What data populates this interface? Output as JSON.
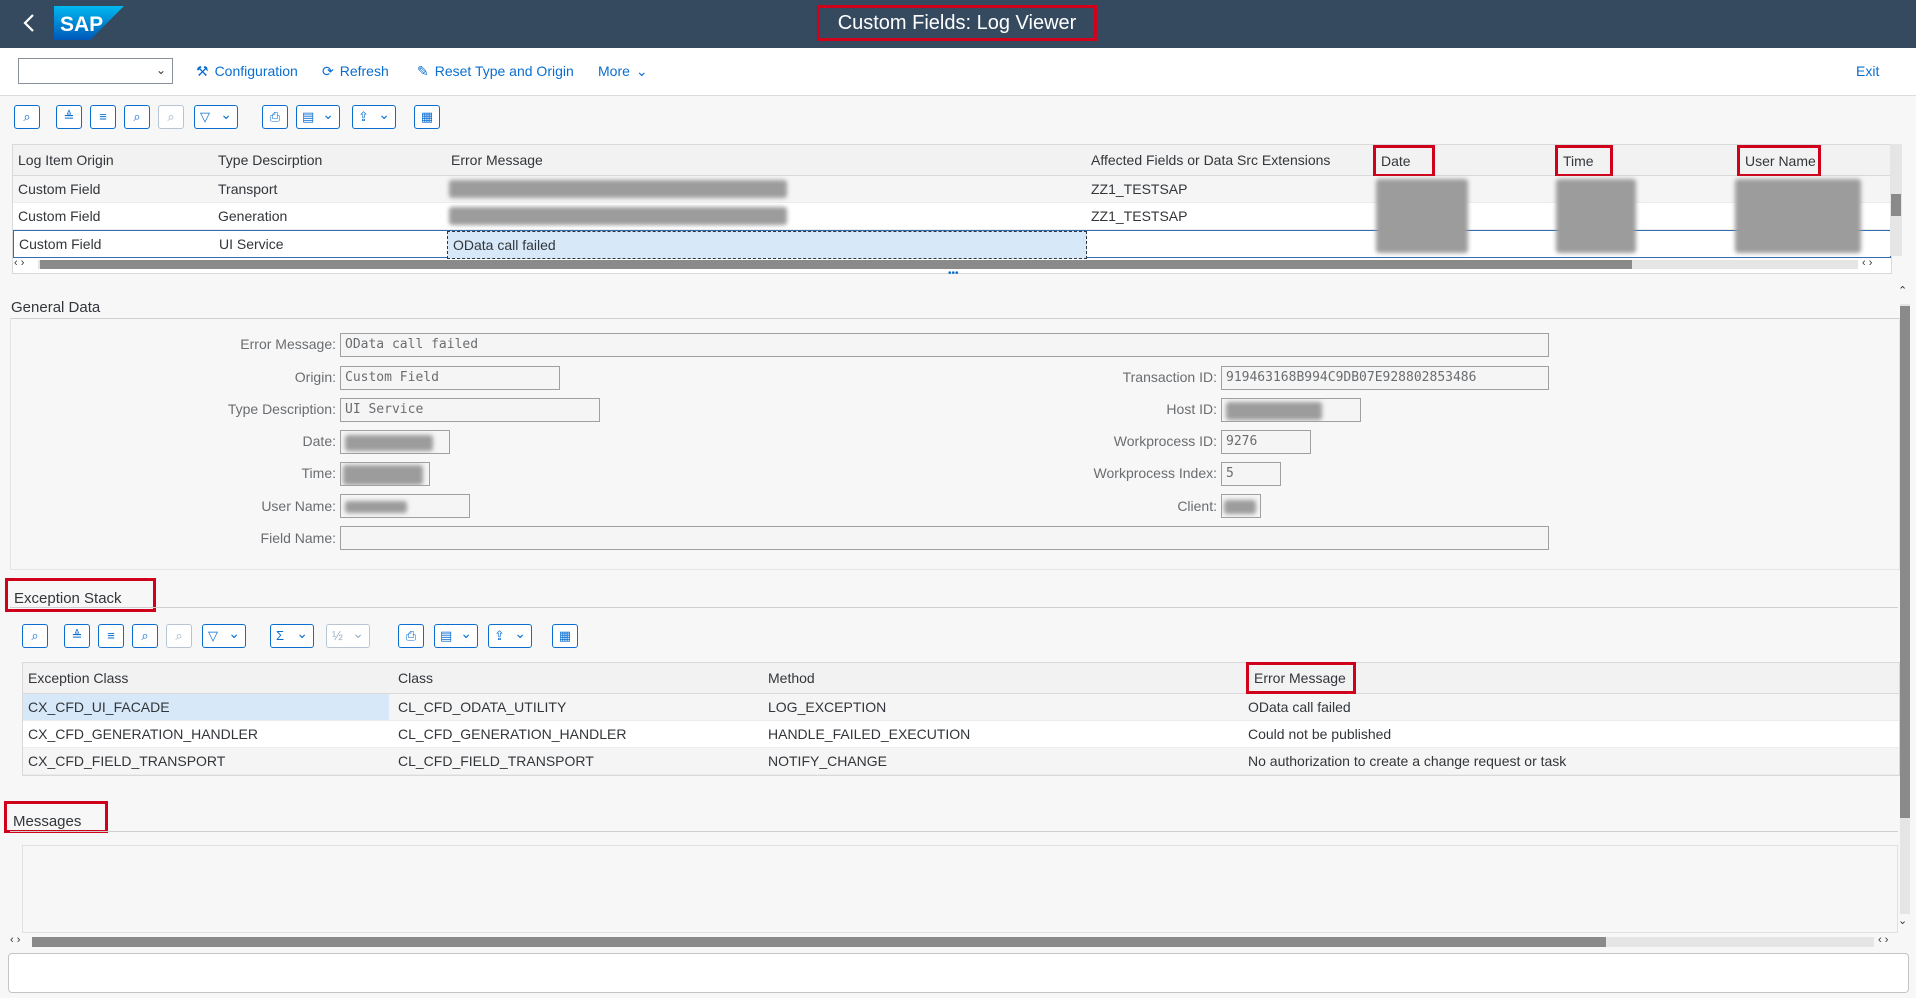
{
  "shell": {
    "title": "Custom Fields: Log Viewer",
    "logo_text": "SAP"
  },
  "toolbar": {
    "configuration": "Configuration",
    "refresh": "Refresh",
    "reset": "Reset Type and Origin",
    "more": "More",
    "exit": "Exit"
  },
  "log_table": {
    "columns": [
      "Log Item Origin",
      "Type Descirption",
      "Error Message",
      "Affected Fields or Data Src Extensions",
      "Date",
      "Time",
      "User Name"
    ],
    "rows": [
      {
        "origin": "Custom Field",
        "type": "Transport",
        "message": "",
        "affected": "ZZ1_TESTSAP"
      },
      {
        "origin": "Custom Field",
        "type": "Generation",
        "message": "",
        "affected": "ZZ1_TESTSAP"
      },
      {
        "origin": "Custom Field",
        "type": "UI Service",
        "message": "OData call failed",
        "affected": ""
      }
    ]
  },
  "general": {
    "title": "General Data",
    "error_message_label": "Error Message:",
    "error_message": "OData call failed",
    "origin_label": "Origin:",
    "origin": "Custom Field",
    "type_label": "Type Description:",
    "type": "UI Service",
    "date_label": "Date:",
    "time_label": "Time:",
    "user_label": "User Name:",
    "field_label": "Field Name:",
    "transaction_label": "Transaction ID:",
    "transaction": "919463168B994C9DB07E928802853486",
    "host_label": "Host ID:",
    "workprocess_label": "Workprocess ID:",
    "workprocess": "9276",
    "wp_index_label": "Workprocess Index:",
    "wp_index": "5",
    "client_label": "Client:"
  },
  "exceptions": {
    "title": "Exception Stack",
    "columns": [
      "Exception Class",
      "Class",
      "Method",
      "Error Message"
    ],
    "rows": [
      {
        "exc": "CX_CFD_UI_FACADE",
        "cls": "CL_CFD_ODATA_UTILITY",
        "method": "LOG_EXCEPTION",
        "msg": "OData call failed"
      },
      {
        "exc": "CX_CFD_GENERATION_HANDLER",
        "cls": "CL_CFD_GENERATION_HANDLER",
        "method": "HANDLE_FAILED_EXECUTION",
        "msg": "Could not be published"
      },
      {
        "exc": "CX_CFD_FIELD_TRANSPORT",
        "cls": "CL_CFD_FIELD_TRANSPORT",
        "method": "NOTIFY_CHANGE",
        "msg": "No authorization to create a change request or task"
      }
    ]
  },
  "messages": {
    "title": "Messages"
  },
  "colors": {
    "shell": "#354a5f",
    "accent": "#0a6ed1",
    "highlight": "#d0021b",
    "selected_row": "#d7e8f8"
  }
}
